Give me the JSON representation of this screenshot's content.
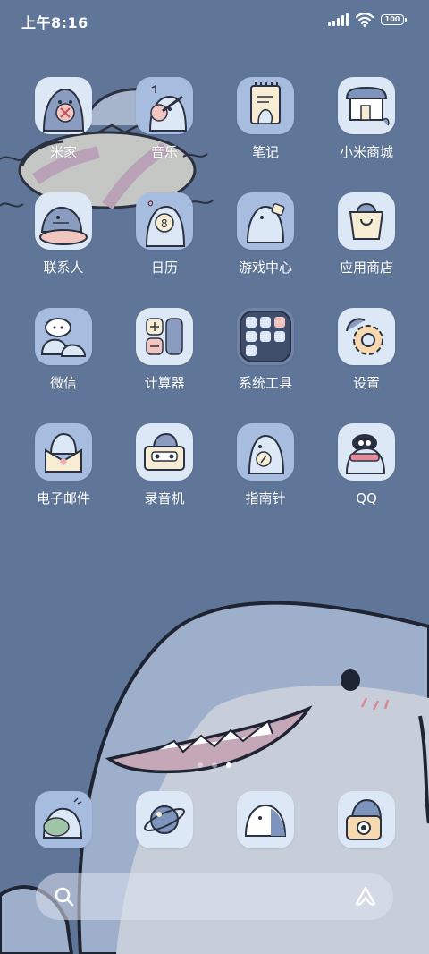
{
  "status_bar": {
    "time": "上午8:16",
    "battery": "100",
    "icons": [
      "signal-icon",
      "wifi-icon",
      "battery-icon"
    ]
  },
  "apps": [
    {
      "label": "米家",
      "icon": "mijia-shark-icon"
    },
    {
      "label": "音乐",
      "icon": "music-shark-guitar-icon"
    },
    {
      "label": "笔记",
      "icon": "notes-shark-notepad-icon"
    },
    {
      "label": "小米商城",
      "icon": "mi-store-shark-house-icon"
    },
    {
      "label": "联系人",
      "icon": "contacts-shark-icon"
    },
    {
      "label": "日历",
      "icon": "calendar-shark-number-icon"
    },
    {
      "label": "游戏中心",
      "icon": "game-center-shark-icon"
    },
    {
      "label": "应用商店",
      "icon": "app-store-shark-bag-icon"
    },
    {
      "label": "微信",
      "icon": "wechat-sharks-icon"
    },
    {
      "label": "计算器",
      "icon": "calculator-icon"
    },
    {
      "label": "系统工具",
      "icon": "system-tools-folder-icon"
    },
    {
      "label": "设置",
      "icon": "settings-gear-shark-icon"
    },
    {
      "label": "电子邮件",
      "icon": "email-shark-envelope-icon"
    },
    {
      "label": "录音机",
      "icon": "recorder-shark-cassette-icon"
    },
    {
      "label": "指南针",
      "icon": "compass-shark-icon"
    },
    {
      "label": "QQ",
      "icon": "qq-penguin-shark-icon"
    }
  ],
  "page_indicator": {
    "count": 3,
    "active": 3
  },
  "dock": [
    {
      "icon": "phone-shark-icon"
    },
    {
      "icon": "browser-planet-icon"
    },
    {
      "icon": "messages-shark-icon"
    },
    {
      "icon": "camera-shark-icon"
    }
  ],
  "search": {
    "icon": "search-icon",
    "assistant_icon": "assistant-icon"
  },
  "colors": {
    "background": "#5f7699",
    "icon_light": "#dde8f7",
    "icon_dark": "#a7bde0",
    "shark": "#8a9cbf"
  }
}
